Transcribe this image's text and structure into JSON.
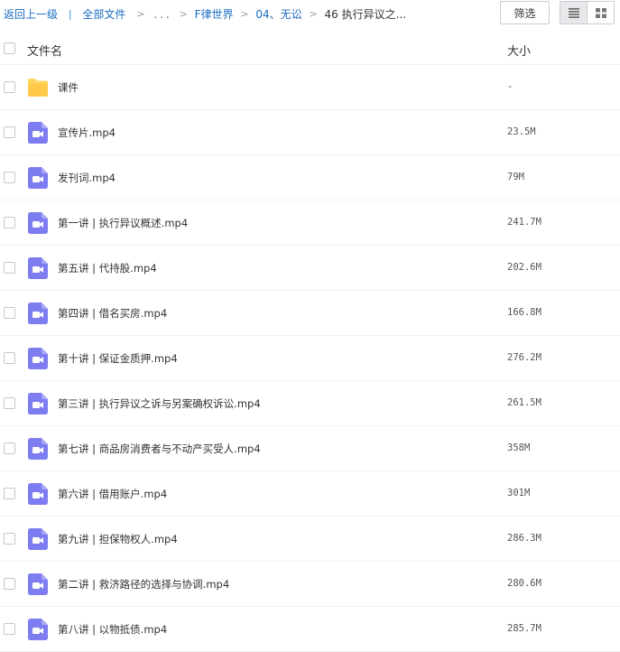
{
  "breadcrumb": {
    "back": "返回上一级",
    "separator": "|",
    "all_files": "全部文件",
    "ellipsis": "...",
    "arrow": ">",
    "items": [
      "F律世界",
      "04、无讼"
    ],
    "current": "46 执行异议之..."
  },
  "toolbar": {
    "filter_label": "筛选",
    "view_mode": "list"
  },
  "header": {
    "name_col": "文件名",
    "size_col": "大小"
  },
  "colors": {
    "link": "#1a6cc2",
    "folder": "#ffd45b",
    "video": "#7d7cf0"
  },
  "files": [
    {
      "icon": "folder-icon",
      "name": "课件",
      "size": "-"
    },
    {
      "icon": "video-file-icon",
      "name": "宣传片.mp4",
      "size": "23.5M"
    },
    {
      "icon": "video-file-icon",
      "name": "发刊词.mp4",
      "size": "79M"
    },
    {
      "icon": "video-file-icon",
      "name": "第一讲 | 执行异议概述.mp4",
      "size": "241.7M"
    },
    {
      "icon": "video-file-icon",
      "name": "第五讲 | 代持股.mp4",
      "size": "202.6M"
    },
    {
      "icon": "video-file-icon",
      "name": "第四讲 | 借名买房.mp4",
      "size": "166.8M"
    },
    {
      "icon": "video-file-icon",
      "name": "第十讲 | 保证金质押.mp4",
      "size": "276.2M"
    },
    {
      "icon": "video-file-icon",
      "name": "第三讲 | 执行异议之诉与另案确权诉讼.mp4",
      "size": "261.5M"
    },
    {
      "icon": "video-file-icon",
      "name": "第七讲 | 商品房消费者与不动产买受人.mp4",
      "size": "358M"
    },
    {
      "icon": "video-file-icon",
      "name": "第六讲 | 借用账户.mp4",
      "size": "301M"
    },
    {
      "icon": "video-file-icon",
      "name": "第九讲 | 担保物权人.mp4",
      "size": "286.3M"
    },
    {
      "icon": "video-file-icon",
      "name": "第二讲 | 救济路径的选择与协调.mp4",
      "size": "280.6M"
    },
    {
      "icon": "video-file-icon",
      "name": "第八讲 | 以物抵债.mp4",
      "size": "285.7M"
    }
  ]
}
